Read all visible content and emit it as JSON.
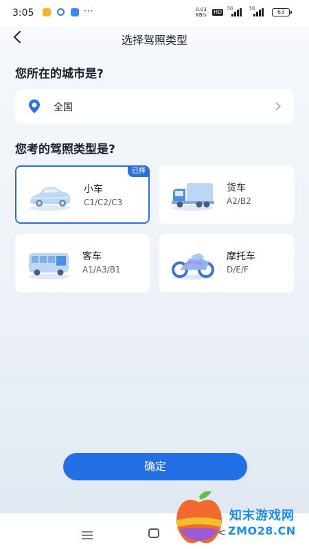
{
  "status_bar": {
    "time": "3:05",
    "more": "···",
    "net_speed_value": "0.03",
    "net_speed_unit": "KB/s",
    "hd": "HD",
    "signal_1": "5G",
    "signal_2": "5G",
    "battery": "63"
  },
  "header": {
    "title": "选择驾照类型"
  },
  "city_section": {
    "heading": "您所在的城市是?",
    "value": "全国"
  },
  "license_section": {
    "heading": "您考的驾照类型是?",
    "selected_badge": "已择",
    "cards": [
      {
        "name": "小车",
        "codes": "C1/C2/C3",
        "icon": "car-icon",
        "selected": true
      },
      {
        "name": "货车",
        "codes": "A2/B2",
        "icon": "truck-icon",
        "selected": false
      },
      {
        "name": "客车",
        "codes": "A1/A3/B1",
        "icon": "bus-icon",
        "selected": false
      },
      {
        "name": "摩托车",
        "codes": "D/E/F",
        "icon": "motorcycle-icon",
        "selected": false
      }
    ]
  },
  "confirm_label": "确定",
  "watermark": {
    "cn": "知末游戏网",
    "en": "ZMO28.CN"
  },
  "colors": {
    "accent": "#2370e6",
    "selected_border": "#2e6fe0"
  }
}
